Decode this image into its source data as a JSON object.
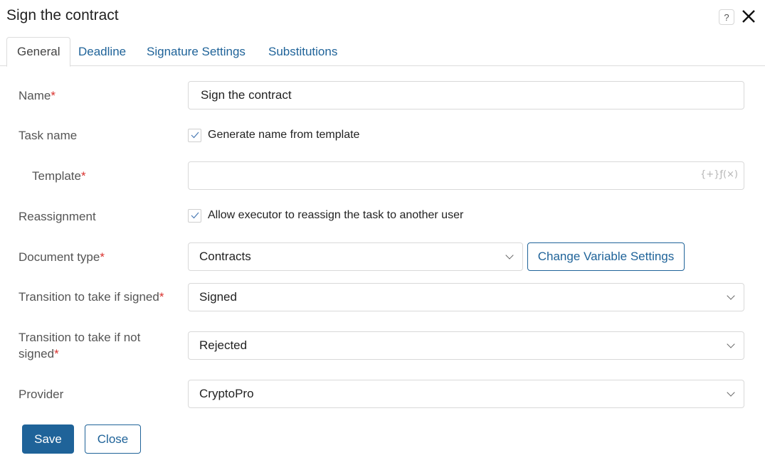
{
  "dialog": {
    "title": "Sign the contract",
    "help_icon": "help-icon",
    "close_icon": "close-icon"
  },
  "tabs": [
    {
      "label": "General",
      "active": true
    },
    {
      "label": "Deadline",
      "active": false
    },
    {
      "label": "Signature Settings",
      "active": false
    },
    {
      "label": "Substitutions",
      "active": false
    }
  ],
  "form": {
    "name": {
      "label": "Name",
      "required_mark": "*",
      "value": "Sign the contract"
    },
    "task_name": {
      "label": "Task name",
      "checkbox_label": "Generate name from template",
      "checked": true
    },
    "template": {
      "label": "Template",
      "required_mark": "*",
      "value": "",
      "function_icon_text": "{+}ƒ(×)"
    },
    "reassignment": {
      "label": "Reassignment",
      "checkbox_label": "Allow executor to reassign the task to another user",
      "checked": true
    },
    "document_type": {
      "label": "Document type",
      "required_mark": "*",
      "value": "Contracts",
      "button_label": "Change Variable Settings"
    },
    "transition_signed": {
      "label": "Transition to take if signed",
      "required_mark": "*",
      "value": "Signed"
    },
    "transition_not_signed": {
      "label_line1": "Transition to take if not",
      "label_line2": "signed",
      "required_mark": "*",
      "value": "Rejected"
    },
    "provider": {
      "label": "Provider",
      "value": "CryptoPro"
    }
  },
  "footer": {
    "save_label": "Save",
    "close_label": "Close"
  },
  "colors": {
    "accent": "#1f6399",
    "required": "#d9322e",
    "border": "#d9d9d9"
  }
}
